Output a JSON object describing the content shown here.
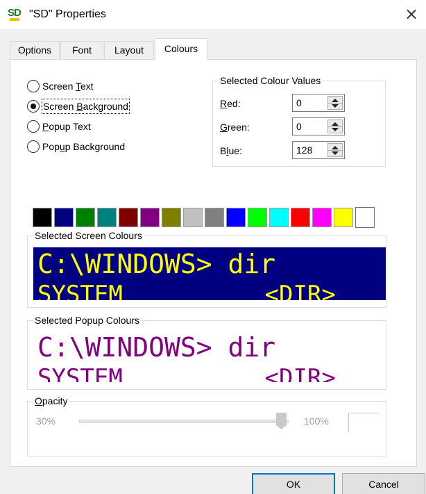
{
  "window": {
    "title": "\"SD\" Properties",
    "icon_text": "SD",
    "icon": "sd-app-icon",
    "close_icon": "close-icon"
  },
  "tabs": [
    {
      "label": "Options",
      "active": false
    },
    {
      "label": "Font",
      "active": false
    },
    {
      "label": "Layout",
      "active": false
    },
    {
      "label": "Colours",
      "active": true
    }
  ],
  "radios": [
    {
      "label": "Screen Text",
      "accel": "T",
      "checked": false
    },
    {
      "label": "Screen Background",
      "accel": "B",
      "checked": true
    },
    {
      "label": "Popup Text",
      "accel": "P",
      "checked": false
    },
    {
      "label": "Popup Background",
      "accel": "u",
      "checked": false
    }
  ],
  "colour_values": {
    "title": "Selected Colour Values",
    "red_label": "Red:",
    "green_label": "Green:",
    "blue_label": "Blue:",
    "red": "0",
    "green": "0",
    "blue": "128"
  },
  "palette": [
    "#000000",
    "#000080",
    "#008000",
    "#008080",
    "#800000",
    "#800080",
    "#808000",
    "#c0c0c0",
    "#808080",
    "#0000ff",
    "#00ff00",
    "#00ffff",
    "#ff0000",
    "#ff00ff",
    "#ffff00",
    "#ffffff"
  ],
  "screen_preview": {
    "title": "Selected Screen Colours",
    "line1": "C:\\WINDOWS> dir",
    "line2": "SYSTEM          <DIR>",
    "text_color": "#ffff00",
    "background_color": "#000080"
  },
  "popup_preview": {
    "title": "Selected Popup Colours",
    "line1": "C:\\WINDOWS> dir",
    "line2": "SYSTEM          <DIR>",
    "text_color": "#800080",
    "background_color": "#ffffff"
  },
  "opacity": {
    "title": "Opacity",
    "accel": "O",
    "min_label": "30%",
    "max_label": "100%",
    "value_percent": 100,
    "enabled": false
  },
  "buttons": {
    "ok": "OK",
    "cancel": "Cancel"
  }
}
